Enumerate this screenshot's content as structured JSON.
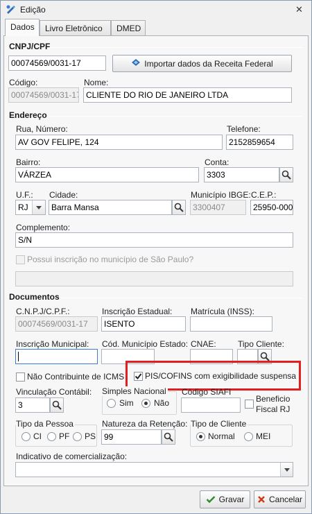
{
  "window": {
    "title": "Edição",
    "close_glyph": "✕"
  },
  "tabs": [
    {
      "label": "Dados"
    },
    {
      "label": "Livro Eletrônico"
    },
    {
      "label": "DMED"
    }
  ],
  "cnpj_section": {
    "title": "CNPJ/CPF",
    "value": "00074569/0031-17",
    "import_button": "Importar dados da Receita Federal",
    "codigo_label": "Código:",
    "codigo_value": "00074569/0031-17",
    "nome_label": "Nome:",
    "nome_value": "CLIENTE DO RIO DE JANEIRO LTDA"
  },
  "endereco": {
    "title": "Endereço",
    "rua_label": "Rua, Número:",
    "rua_value": "AV GOV FELIPE, 124",
    "telefone_label": "Telefone:",
    "telefone_value": "2152859654",
    "bairro_label": "Bairro:",
    "bairro_value": "VÁRZEA",
    "conta_label": "Conta:",
    "conta_value": "3303",
    "uf_label": "U.F.:",
    "uf_value": "RJ",
    "cidade_label": "Cidade:",
    "cidade_value": "Barra Mansa",
    "ibge_label": "Município IBGE:",
    "ibge_value": "3300407",
    "cep_label": "C.E.P.:",
    "cep_value": "25950-000",
    "complemento_label": "Complemento:",
    "complemento_value": "S/N",
    "sp_check_label": "Possui inscrição no município de São Paulo?"
  },
  "documentos": {
    "title": "Documentos",
    "cnpj_label": "C.N.P.J/C.P.F.:",
    "cnpj_value": "00074569/0031-17",
    "ie_label": "Inscrição Estadual:",
    "ie_value": "ISENTO",
    "matricula_label": "Matrícula (INSS):",
    "matricula_value": "",
    "im_label": "Inscrição Municipal:",
    "im_value": "",
    "cod_mun_label": "Cód. Município Estado:",
    "cnae_label": "CNAE:",
    "tipo_cliente_label": "Tipo Cliente:",
    "nao_contrib_label": "Não Contribuinte de ICMS",
    "pis_label": "PIS/COFINS com exigibilidade suspensa",
    "vinc_label": "Vinculação Contábil:",
    "vinc_value": "3",
    "simples_label": "Simples Nacional",
    "simples_sim": "Sim",
    "simples_nao": "Não",
    "siafi_label": "Código SIAFI",
    "benef_label_1": "Beneficio",
    "benef_label_2": "Fiscal RJ",
    "tipo_pessoa_label": "Tipo da Pessoa",
    "tp_ci": "CI",
    "tp_pf": "PF",
    "tp_ps": "PS",
    "natureza_label": "Natureza da Retenção:",
    "natureza_value": "99",
    "tipo_de_cliente_label": "Tipo de Cliente",
    "tc_normal": "Normal",
    "tc_mei": "MEI",
    "indicativo_label": "Indicativo de comercialização:",
    "indicativo_value": ""
  },
  "footer": {
    "gravar": "Gravar",
    "cancelar": "Cancelar"
  },
  "colors": {
    "highlight": "#e02020",
    "accent": "#3a7bd5"
  }
}
